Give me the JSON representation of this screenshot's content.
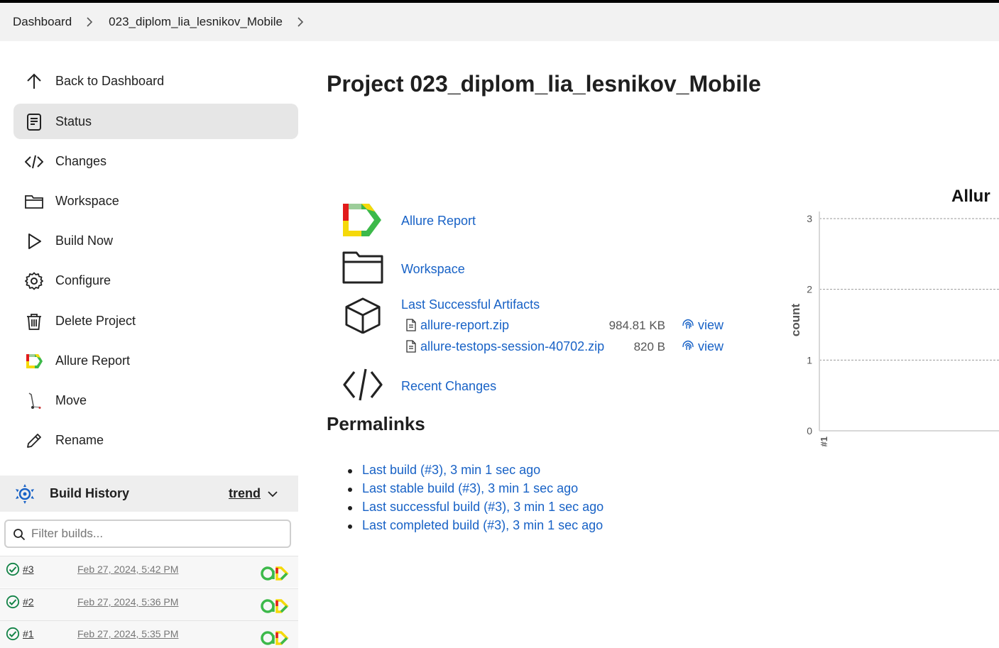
{
  "breadcrumbs": [
    "Dashboard",
    "023_diplom_lia_lesnikov_Mobile"
  ],
  "sidebar": {
    "items": [
      {
        "label": "Back to Dashboard",
        "icon": "arrow-up-icon"
      },
      {
        "label": "Status",
        "icon": "document-icon",
        "active": true
      },
      {
        "label": "Changes",
        "icon": "code-icon"
      },
      {
        "label": "Workspace",
        "icon": "folder-icon"
      },
      {
        "label": "Build Now",
        "icon": "play-icon"
      },
      {
        "label": "Configure",
        "icon": "gear-icon"
      },
      {
        "label": "Delete Project",
        "icon": "trash-icon"
      },
      {
        "label": "Allure Report",
        "icon": "allure-icon"
      },
      {
        "label": "Move",
        "icon": "move-icon"
      },
      {
        "label": "Rename",
        "icon": "pencil-icon"
      }
    ]
  },
  "build_history": {
    "title": "Build History",
    "trend_label": "trend",
    "filter_placeholder": "Filter builds...",
    "builds": [
      {
        "number": "#3",
        "date": "Feb 27, 2024, 5:42 PM",
        "status": "success"
      },
      {
        "number": "#2",
        "date": "Feb 27, 2024, 5:36 PM",
        "status": "success"
      },
      {
        "number": "#1",
        "date": "Feb 27, 2024, 5:35 PM",
        "status": "success"
      }
    ]
  },
  "main": {
    "title": "Project 023_diplom_lia_lesnikov_Mobile",
    "links": {
      "allure_report": "Allure Report",
      "workspace": "Workspace",
      "last_successful_artifacts": "Last Successful Artifacts",
      "recent_changes": "Recent Changes"
    },
    "artifacts": [
      {
        "name": "allure-report.zip",
        "size": "984.81 KB",
        "view": "view"
      },
      {
        "name": "allure-testops-session-40702.zip",
        "size": "820 B",
        "view": "view"
      }
    ],
    "permalinks_title": "Permalinks",
    "permalinks": [
      "Last build (#3), 3 min 1 sec ago",
      "Last stable build (#3), 3 min 1 sec ago",
      "Last successful build (#3), 3 min 1 sec ago",
      "Last completed build (#3), 3 min 1 sec ago"
    ]
  },
  "colors": {
    "link": "#1862c6",
    "success": "#138347",
    "allure_green": "#3cb94a",
    "allure_yellow": "#f5d90a",
    "allure_red": "#e21b1b"
  },
  "chart_data": {
    "type": "area",
    "title": "Allur",
    "ylabel": "count",
    "xlabel": "",
    "y_ticks": [
      0,
      1,
      2,
      3
    ],
    "ylim": [
      0,
      3.1
    ],
    "categories": [
      "#1"
    ],
    "grid": true
  }
}
